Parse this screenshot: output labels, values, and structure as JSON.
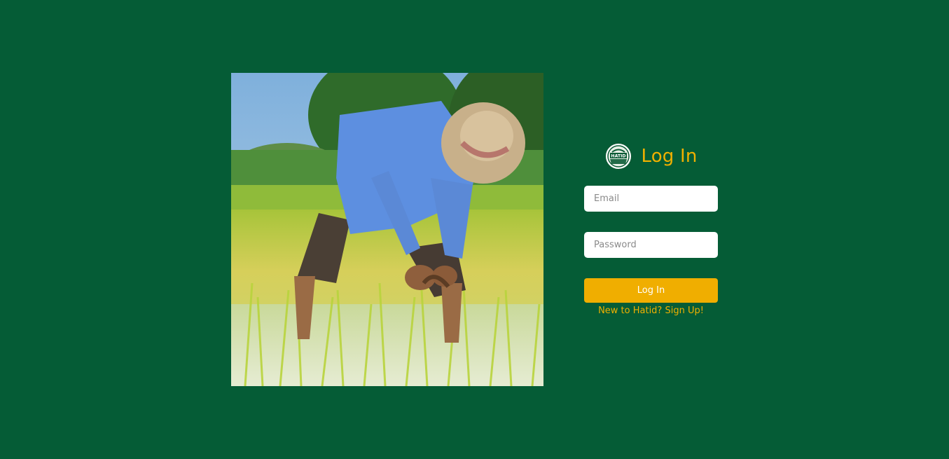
{
  "colors": {
    "background": "#055c36",
    "accent": "#f0b000",
    "button": "#f0ae00",
    "input_bg": "#ffffff"
  },
  "hero_image": {
    "subject": "farmer planting rice seedlings in a flooded paddy field",
    "icon": "photo"
  },
  "login": {
    "logo_text": "HATID",
    "logo_icon": "hatid-logo-icon",
    "title": "Log In",
    "email_placeholder": "Email",
    "password_placeholder": "Password",
    "submit_label": "Log In",
    "signup_text": "New to Hatid? Sign Up!"
  }
}
